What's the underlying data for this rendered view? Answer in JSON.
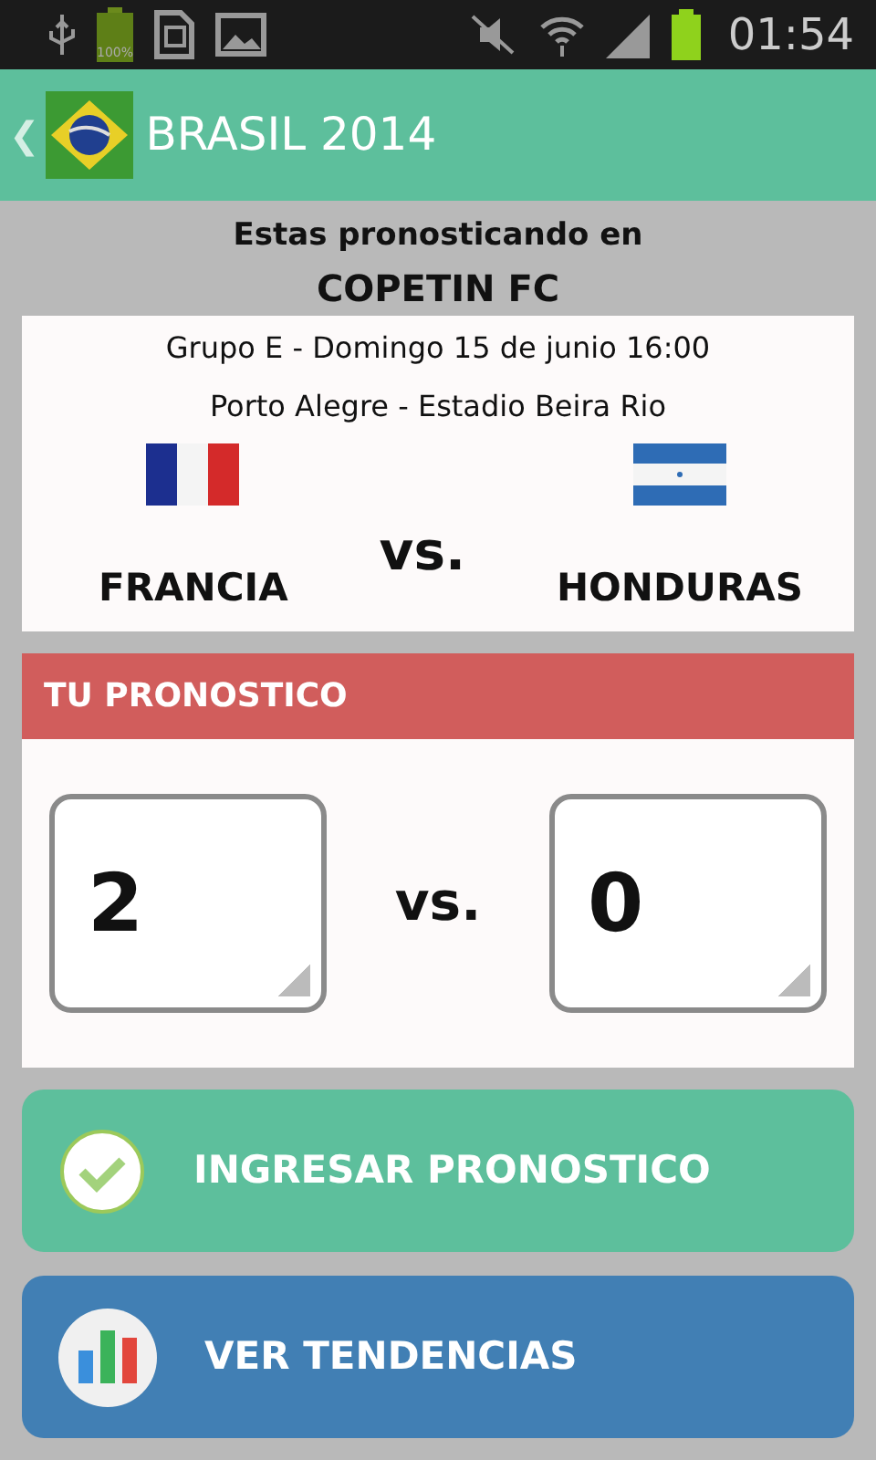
{
  "status_bar": {
    "battery_label": "100%",
    "time": "01:54"
  },
  "app_bar": {
    "back": "❮",
    "title": "BRASIL 2014"
  },
  "intro": {
    "line": "Estas pronosticando en",
    "group_name": "COPETIN FC"
  },
  "match": {
    "info": "Grupo E - Domingo 15 de junio 16:00",
    "venue": "Porto Alegre - Estadio Beira Rio",
    "separator": "vs.",
    "teams": [
      {
        "name": "FRANCIA",
        "kind": "france"
      },
      {
        "name": "HONDURAS",
        "kind": "honduras"
      }
    ]
  },
  "prediction": {
    "title": "TU PRONOSTICO",
    "separator": "vs.",
    "scores": [
      "2",
      "0"
    ]
  },
  "buttons": [
    {
      "label": "INGRESAR PRONOSTICO",
      "kind": "confirm"
    },
    {
      "label": "VER TENDENCIAS",
      "kind": "trends"
    }
  ]
}
